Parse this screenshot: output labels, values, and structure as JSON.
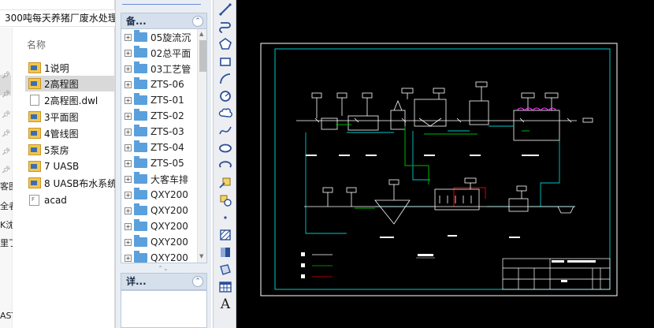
{
  "explorer": {
    "path": "300吨每天养猪厂废水处理",
    "column_header": "名称",
    "nav_fragments": [
      "客图",
      "全者",
      "K沈",
      "里丁",
      "AST"
    ],
    "files": [
      {
        "name": "1说明",
        "icon": "dwg-file-icon",
        "selected": false
      },
      {
        "name": "2高程图",
        "icon": "dwg-file-icon",
        "selected": true
      },
      {
        "name": "2高程图.dwl",
        "icon": "document-icon",
        "selected": false
      },
      {
        "name": "3平面图",
        "icon": "dwg-file-icon",
        "selected": false
      },
      {
        "name": "4管线图",
        "icon": "dwg-file-icon",
        "selected": false
      },
      {
        "name": "5泵房",
        "icon": "dwg-file-icon",
        "selected": false
      },
      {
        "name": "7 UASB",
        "icon": "dwg-file-icon",
        "selected": false
      },
      {
        "name": "8 UASB布水系统",
        "icon": "dwg-file-icon",
        "selected": false
      },
      {
        "name": "acad",
        "icon": "font-file-icon",
        "selected": false
      }
    ]
  },
  "design_center": {
    "folders_header": "备...",
    "details_header": "详...",
    "tree_items": [
      "05旋流沉",
      "02总平面",
      "03工艺管",
      "ZTS-06",
      "ZTS-01",
      "ZTS-02",
      "ZTS-03",
      "ZTS-04",
      "ZTS-05",
      "大客车排",
      "QXY200",
      "QXY200",
      "QXY200",
      "QXY200",
      "QXY200"
    ]
  },
  "toolbar": {
    "tools": [
      "line-icon",
      "polyline-icon",
      "polygon-icon",
      "rectangle-icon",
      "arc-icon",
      "circle-icon",
      "revision-cloud-icon",
      "spline-icon",
      "ellipse-icon",
      "ellipse-arc-icon",
      "insert-block-icon",
      "make-block-icon",
      "point-icon",
      "hatch-icon",
      "gradient-icon",
      "region-icon",
      "table-icon",
      "multiline-text-icon"
    ],
    "text_tool_glyph": "A"
  },
  "colors": {
    "viewport_bg": "#000000",
    "drawing_frame": "#00c8c8",
    "drawing_lines": "#ffffff",
    "pipe_green": "#00b400",
    "pipe_red": "#e00000",
    "folder_blue": "#5aa0dc",
    "dwg_yellow": "#f3c64a"
  }
}
